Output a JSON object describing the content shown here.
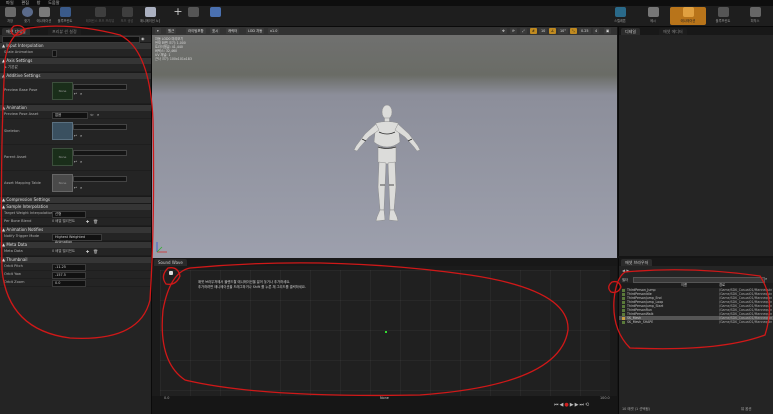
{
  "menu": [
    "파일",
    "편집",
    "창",
    "도움말"
  ],
  "toolbar": {
    "buttons": [
      "저장",
      "찾기",
      "애니메이션",
      "블루프린트",
      "레퍼런스 포즈 프리뷰",
      "포즈 생성",
      "애니메이션 노출"
    ],
    "right_buttons": [
      "스켈레톤",
      "메시",
      "애니메이션",
      "블루프린트",
      "피직스"
    ]
  },
  "left_panel": {
    "tabs": [
      "애셋 디테일",
      "프리뷰 씬 설정"
    ],
    "categories": [
      {
        "title": "Input Interpolation",
        "rows": [
          {
            "label": "Scale Animation",
            "value": ""
          }
        ]
      },
      {
        "title": "Axis Settings",
        "rows": [
          {
            "label": "▶ 기본값",
            "value": ""
          }
        ]
      },
      {
        "title": "Additive Settings",
        "rows": [
          {
            "label": "Preview Base Pose",
            "value": "None"
          }
        ]
      },
      {
        "title": "Animation",
        "rows": [
          {
            "label": "Preview Pose Asset",
            "value": "없음"
          },
          {
            "label": "Skeleton",
            "value": ""
          },
          {
            "label": "Parent Asset",
            "value": "None"
          },
          {
            "label": "Asset Mapping Table",
            "value": "None"
          }
        ]
      },
      {
        "title": "Compression Settings",
        "rows": []
      },
      {
        "title": "Sample Interpolation",
        "rows": [
          {
            "label": "Target Weight Interpolation Ea.",
            "value": "선형"
          },
          {
            "label": "Per Bone Blend",
            "value": "0 배열 엘리먼트"
          }
        ]
      },
      {
        "title": "Animation Notifies",
        "rows": [
          {
            "label": "Notify Trigger Mode",
            "value": "Highest Weighted Animation"
          }
        ]
      },
      {
        "title": "Meta Data",
        "rows": [
          {
            "label": "Meta Data",
            "value": "0 배열 엘리먼트"
          }
        ]
      },
      {
        "title": "Thumbnail",
        "rows": [
          {
            "label": "Orbit Pitch",
            "value": "-11.25"
          },
          {
            "label": "Orbit Yaw",
            "value": "-157.5"
          },
          {
            "label": "Orbit Zoom",
            "value": "0.0"
          }
        ]
      }
    ]
  },
  "viewport": {
    "buttons": [
      "원근",
      "라이팅포함",
      "표시",
      "캐릭터",
      "LOD 자동",
      "x1.0"
    ],
    "right_values": [
      "10",
      "10°",
      "0.25",
      "4"
    ],
    "stats": [
      "자동 LOD0 미리보기",
      "현재 화면 크기: 1.000",
      "트라이앵글: 41,440",
      "버텍스: 32,460",
      "UV 채널: 1",
      "근사 크기: 100x101x183"
    ]
  },
  "right_top": {
    "tabs": [
      "디테일",
      "애셋 에디터"
    ]
  },
  "sound_wave": {
    "tab": "Sound Wave",
    "notice_lines": [
      "애셋 브라우저에서 블렌드할 애니메이션을 끌어 놓거나 추가하세요.",
      "추가하려면 애니메이션을 드래그하거나 Shift 를 누른 채 그리드를 클릭하세요."
    ],
    "axis_left": "0.0",
    "axis_right": "100.0",
    "axis_label": "None"
  },
  "asset_browser": {
    "tab": "애셋 브라우저",
    "filter_label": "필터",
    "col_name": "이름",
    "col_path": "경로",
    "rows": [
      {
        "name": "ThirdPerson_Jump",
        "path": "/Game/SDK_Casual01/Mannequin"
      },
      {
        "name": "ThirdPersonIdle",
        "path": "/Game/SDK_Casual01/Mannequin"
      },
      {
        "name": "ThirdPersonJump_End",
        "path": "/Game/SDK_Casual01/Mannequin"
      },
      {
        "name": "ThirdPersonJump_Loop",
        "path": "/Game/SDK_Casual01/Mannequin"
      },
      {
        "name": "ThirdPersonJump_Start",
        "path": "/Game/SDK_Casual01/Mannequin"
      },
      {
        "name": "ThirdPersonRun",
        "path": "/Game/SDK_Casual01/Mannequin"
      },
      {
        "name": "ThirdPersonWalk",
        "path": "/Game/SDK_Casual01/Mannequin"
      },
      {
        "name": "SK_Mesh",
        "path": "/Game/SDK_Casual01/Mannequin"
      },
      {
        "name": "SK_Mesh_SHAPE",
        "path": "/Game/SDK_Casual01/Mannequin"
      }
    ],
    "count_text": "10 애셋 (1 선택됨)",
    "view_options": "뷰 옵션"
  }
}
